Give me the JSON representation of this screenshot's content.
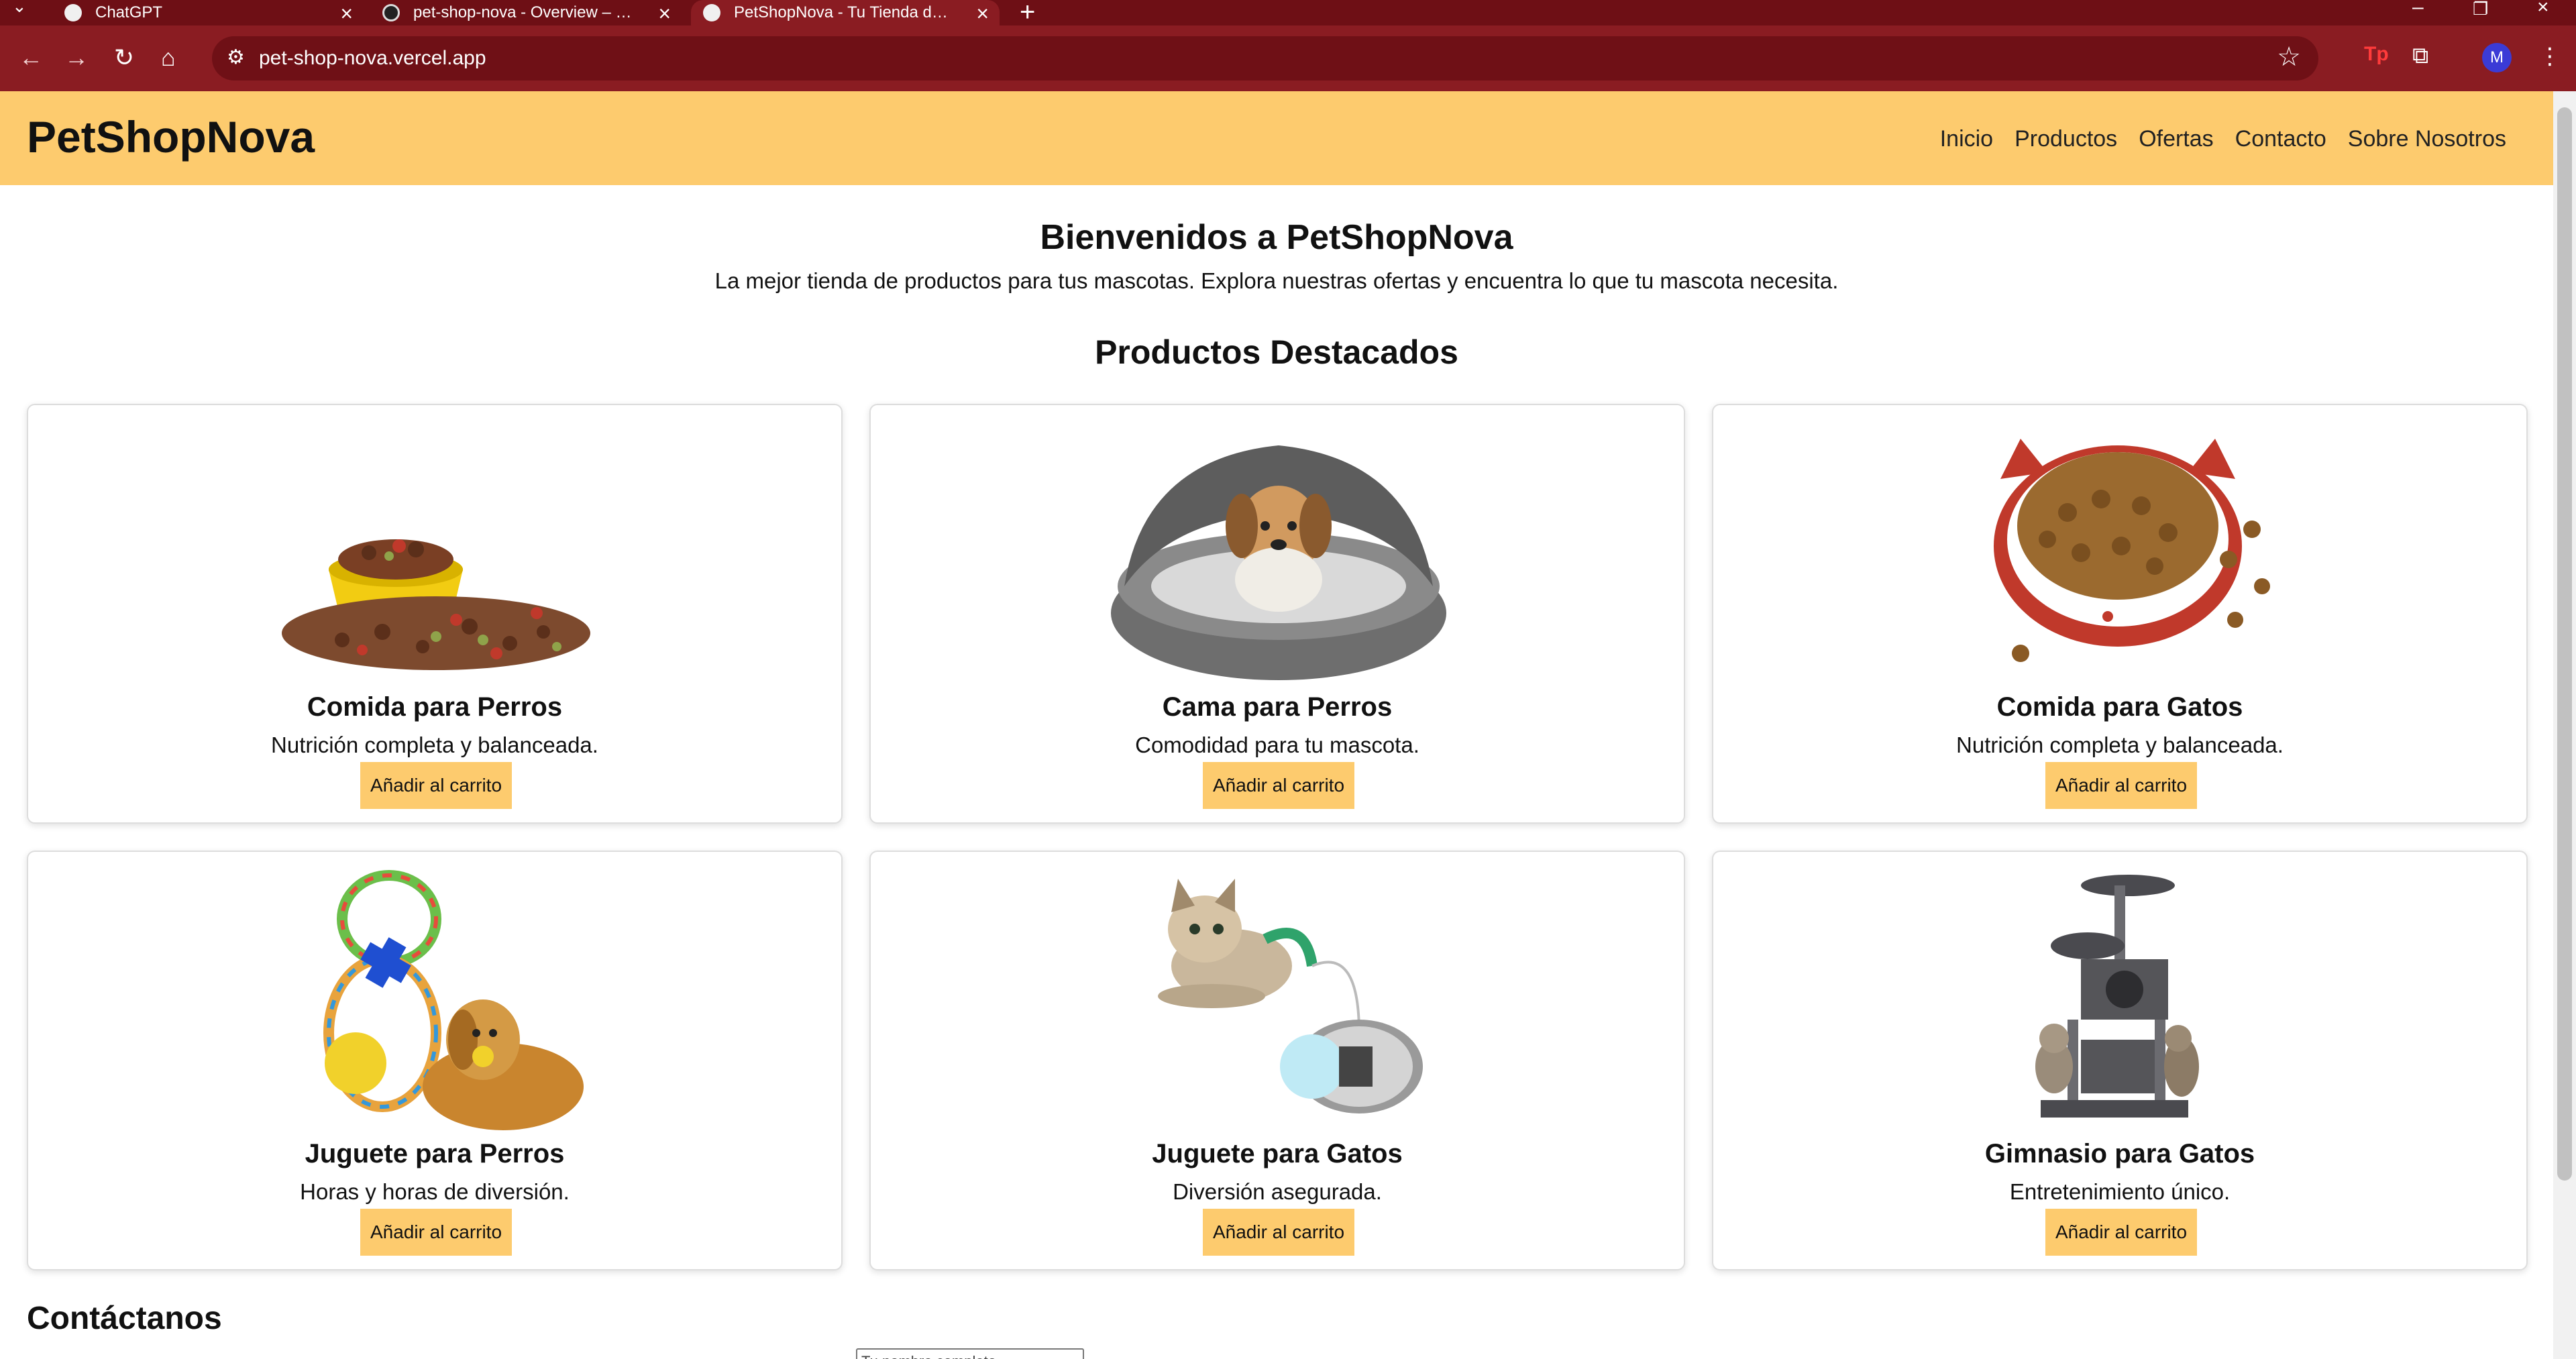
{
  "browser": {
    "tabs": [
      {
        "title": "ChatGPT",
        "active": false
      },
      {
        "title": "pet-shop-nova - Overview – Vercel",
        "active": false
      },
      {
        "title": "PetShopNova - Tu Tienda de Mascotas",
        "active": true
      }
    ],
    "url": "pet-shop-nova.vercel.app",
    "avatar_initial": "M"
  },
  "site": {
    "logo": "PetShopNova",
    "nav": [
      "Inicio",
      "Productos",
      "Ofertas",
      "Contacto",
      "Sobre Nosotros"
    ],
    "hero_title": "Bienvenidos a PetShopNova",
    "hero_subtitle": "La mejor tienda de productos para tus mascotas. Explora nuestras ofertas y encuentra lo que tu mascota necesita.",
    "featured_title": "Productos Destacados",
    "products": [
      {
        "name": "Comida para Perros",
        "description": "Nutrición completa y balanceada.",
        "button": "Añadir al carrito",
        "image": "dog-food-image"
      },
      {
        "name": "Cama para Perros",
        "description": "Comodidad para tu mascota.",
        "button": "Añadir al carrito",
        "image": "dog-bed-image"
      },
      {
        "name": "Comida para Gatos",
        "description": "Nutrición completa y balanceada.",
        "button": "Añadir al carrito",
        "image": "cat-food-image"
      },
      {
        "name": "Juguete para Perros",
        "description": "Horas y horas de diversión.",
        "button": "Añadir al carrito",
        "image": "dog-toy-image"
      },
      {
        "name": "Juguete para Gatos",
        "description": "Diversión asegurada.",
        "button": "Añadir al carrito",
        "image": "cat-toy-image"
      },
      {
        "name": "Gimnasio para Gatos",
        "description": "Entretenimiento único.",
        "button": "Añadir al carrito",
        "image": "cat-tree-image"
      }
    ],
    "contact_title": "Contáctanos",
    "contact_input_value": "Tu nombre completo"
  },
  "colors": {
    "header": "#fdcb6e",
    "button": "#fdcb6e",
    "browser_frame": "#8a1c22"
  }
}
